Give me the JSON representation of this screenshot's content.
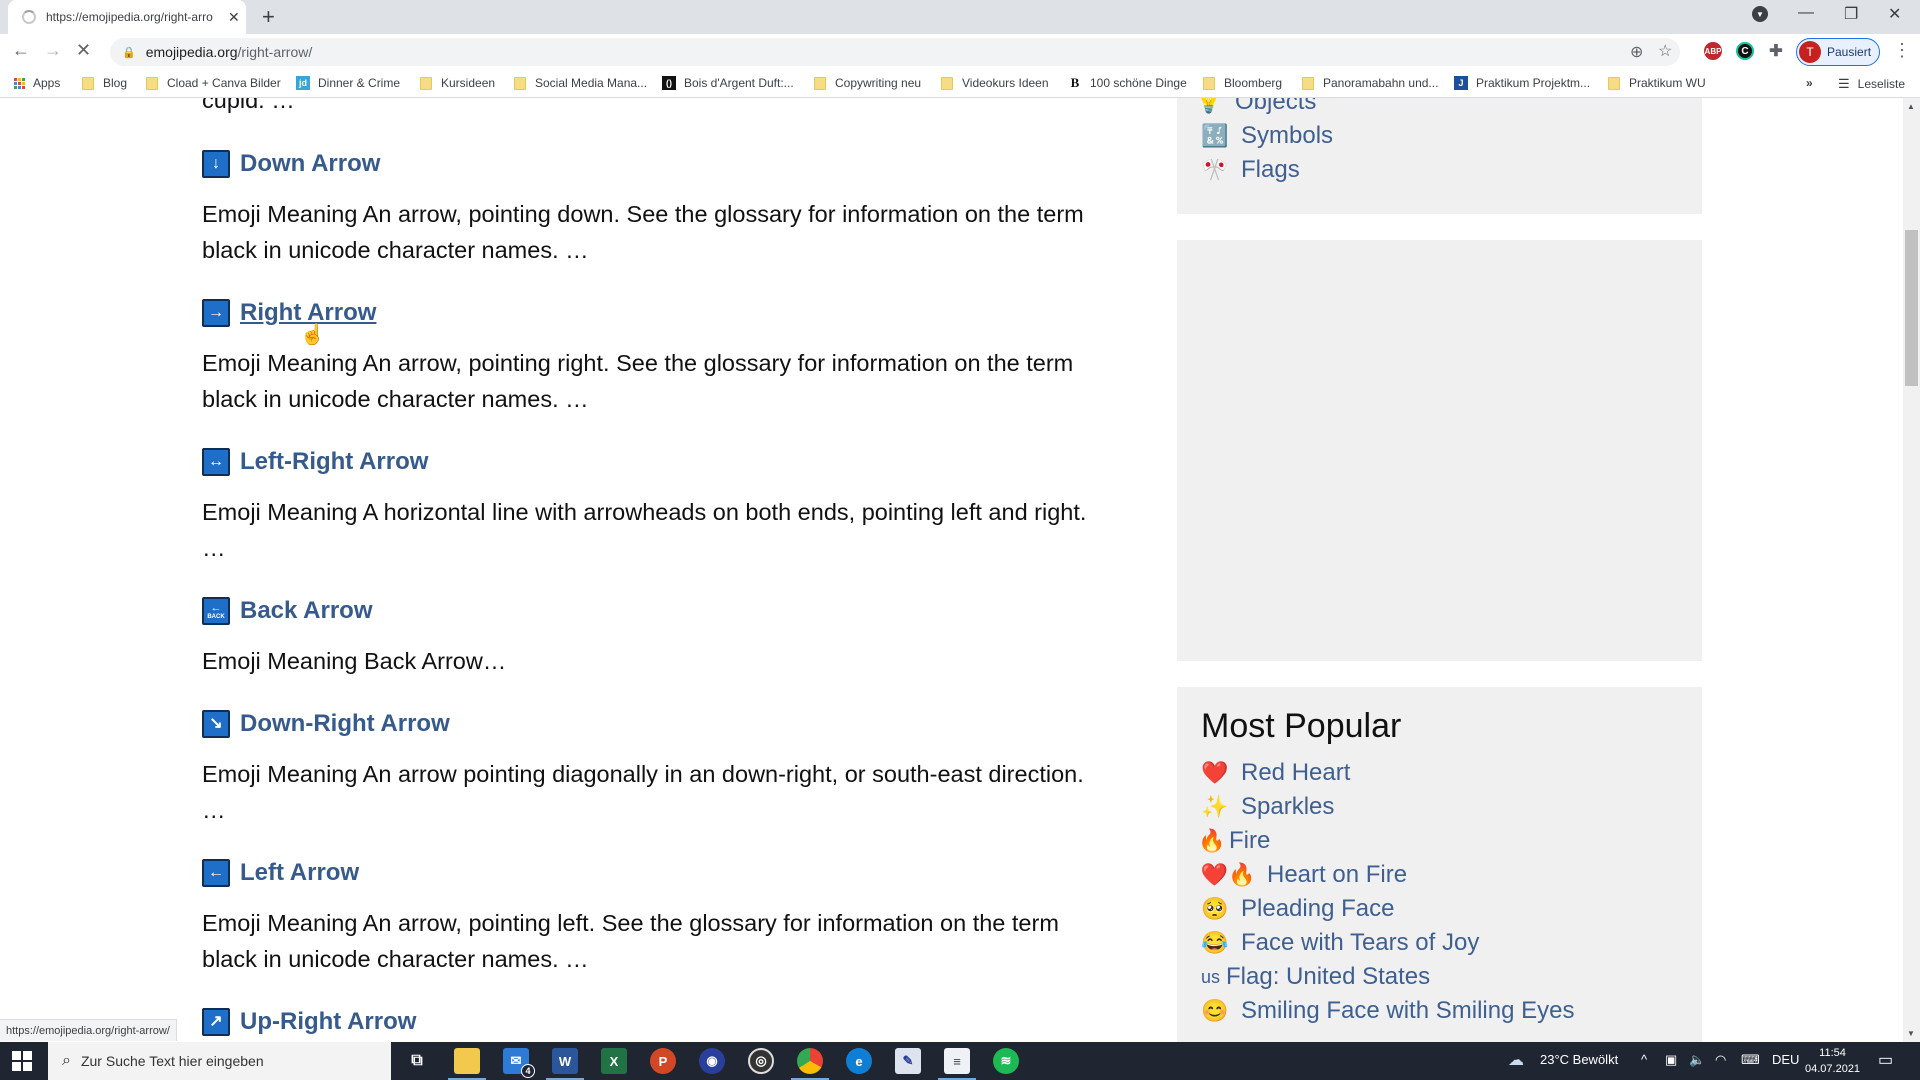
{
  "browser": {
    "tab_title": "https://emojipedia.org/right-arro",
    "url_host": "emojipedia.org",
    "url_path": "/right-arrow/",
    "profile_initial": "T",
    "profile_status": "Pausiert",
    "extensions": [
      "ABP",
      "C"
    ],
    "bookmarks": [
      {
        "label": "Apps",
        "icon": "apps"
      },
      {
        "label": "Blog",
        "icon": "folder"
      },
      {
        "label": "Cload + Canva Bilder",
        "icon": "folder"
      },
      {
        "label": "Dinner & Crime",
        "icon": "jd"
      },
      {
        "label": "Kursideen",
        "icon": "folder"
      },
      {
        "label": "Social Media Mana...",
        "icon": "folder"
      },
      {
        "label": "Bois d'Argent Duft:...",
        "icon": "dark"
      },
      {
        "label": "Copywriting neu",
        "icon": "folder"
      },
      {
        "label": "Videokurs Ideen",
        "icon": "folder"
      },
      {
        "label": "100 schöne Dinge",
        "icon": "B"
      },
      {
        "label": "Bloomberg",
        "icon": "folder"
      },
      {
        "label": "Panoramabahn und...",
        "icon": "folder"
      },
      {
        "label": "Praktikum Projektm...",
        "icon": "J"
      },
      {
        "label": "Praktikum WU",
        "icon": "folder"
      }
    ],
    "bookmarks_overflow": "»",
    "reading_list": "Leseliste",
    "status_url": "https://emojipedia.org/right-arrow/"
  },
  "page": {
    "truncated_text": "cupid. …",
    "entries": [
      {
        "title": "Down Arrow",
        "glyph": "↓",
        "desc": "Emoji Meaning An arrow, pointing down. See the glossary for information on the term black in unicode character names. …"
      },
      {
        "title": "Right Arrow",
        "glyph": "→",
        "desc": "Emoji Meaning An arrow, pointing right. See the glossary for information on the term black in unicode character names. …"
      },
      {
        "title": "Left-Right Arrow",
        "glyph": "↔",
        "desc": "Emoji Meaning A horizontal line with arrowheads on both ends, pointing left and right. …"
      },
      {
        "title": "Back Arrow",
        "glyph": "←",
        "glyph_sub": "BACK",
        "desc": "Emoji Meaning Back Arrow…"
      },
      {
        "title": "Down-Right Arrow",
        "glyph": "↘",
        "desc": "Emoji Meaning An arrow pointing diagonally in an down-right, or south-east direction. …"
      },
      {
        "title": "Left Arrow",
        "glyph": "←",
        "desc": "Emoji Meaning An arrow, pointing left. See the glossary for information on the term black in unicode character names. …"
      },
      {
        "title": "Up-Right Arrow",
        "glyph": "↗",
        "desc": ""
      }
    ]
  },
  "sidebar": {
    "categories": [
      {
        "label": "Objects",
        "emoji": "💡"
      },
      {
        "label": "Symbols",
        "emoji": "🔣"
      },
      {
        "label": "Flags",
        "emoji": "🎌"
      }
    ],
    "most_popular_title": "Most Popular",
    "most_popular": [
      {
        "label": "Red Heart",
        "emoji": "❤️"
      },
      {
        "label": "Sparkles",
        "emoji": "✨"
      },
      {
        "label": "Fire",
        "emoji": "🔥"
      },
      {
        "label": "Heart on Fire",
        "emoji": "❤️🔥"
      },
      {
        "label": "Pleading Face",
        "emoji": "🥺"
      },
      {
        "label": "Face with Tears of Joy",
        "emoji": "😂"
      },
      {
        "label": "Flag: United States",
        "emoji": "us"
      },
      {
        "label": "Smiling Face with Smiling Eyes",
        "emoji": "😊"
      }
    ]
  },
  "taskbar": {
    "search_placeholder": "Zur Suche Text hier eingeben",
    "mail_badge": "4",
    "weather": "23°C  Bewölkt",
    "language": "DEU",
    "time": "11:54",
    "date": "04.07.2021"
  }
}
